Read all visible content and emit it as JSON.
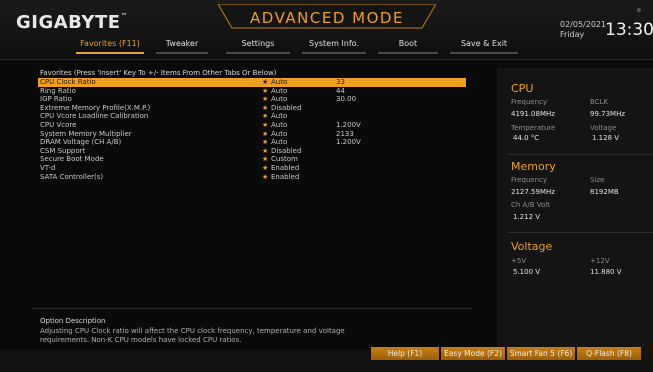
{
  "header": {
    "brand": "GIGABYTE",
    "brand_tm": "™",
    "mode_title": "ADVANCED MODE",
    "date": "02/05/2021",
    "day": "Friday",
    "time": "13:30"
  },
  "tabs": [
    {
      "label": "Favorites (F11)",
      "active": true
    },
    {
      "label": "Tweaker",
      "active": false
    },
    {
      "label": "Settings",
      "active": false
    },
    {
      "label": "System Info.",
      "active": false
    },
    {
      "label": "Boot",
      "active": false
    },
    {
      "label": "Save & Exit",
      "active": false
    }
  ],
  "favorites": {
    "heading": "Favorites (Press 'Insert' Key To +/- Items From Other Tabs Or Below)",
    "items": [
      {
        "label": "CPU Clock Ratio",
        "star": "★",
        "value": "Auto",
        "value2": "33"
      },
      {
        "label": "Ring Ratio",
        "star": "★",
        "value": "Auto",
        "value2": "44"
      },
      {
        "label": "IGP Ratio",
        "star": "★",
        "value": "Auto",
        "value2": "30.00"
      },
      {
        "label": "Extreme Memory Profile(X.M.P.)",
        "star": "★",
        "value": "Disabled",
        "value2": ""
      },
      {
        "label": "CPU Vcore Loadline Calibration",
        "star": "★",
        "value": "Auto",
        "value2": ""
      },
      {
        "label": "CPU Vcore",
        "star": "★",
        "value": "Auto",
        "value2": "1.200V"
      },
      {
        "label": "System Memory Multiplier",
        "star": "★",
        "value": "Auto",
        "value2": "2133"
      },
      {
        "label": "DRAM Voltage    (CH A/B)",
        "star": "★",
        "value": "Auto",
        "value2": "1.200V"
      },
      {
        "label": "CSM Support",
        "star": "★",
        "value": "Disabled",
        "value2": ""
      },
      {
        "label": "Secure Boot Mode",
        "star": "★",
        "value": "Custom",
        "value2": ""
      },
      {
        "label": "VT-d",
        "star": "★",
        "value": "Enabled",
        "value2": ""
      },
      {
        "label": "SATA Controller(s)",
        "star": "★",
        "value": "Enabled",
        "value2": ""
      }
    ]
  },
  "side": {
    "cpu": {
      "title": "CPU",
      "frequency_label": "Frequency",
      "frequency_value": "4191.08MHz",
      "bclk_label": "BCLK",
      "bclk_value": "99.73MHz",
      "temperature_label": "Temperature",
      "temperature_value": "44.0 °C",
      "voltage_label": "Voltage",
      "voltage_value": "1.128 V"
    },
    "memory": {
      "title": "Memory",
      "frequency_label": "Frequency",
      "frequency_value": "2127.59MHz",
      "size_label": "Size",
      "size_value": "8192MB",
      "volt_label": "Ch A/B Volt",
      "volt_value": "1.212 V"
    },
    "voltage": {
      "title": "Voltage",
      "v5_label": "+5V",
      "v5_value": "5.100 V",
      "v12_label": "+12V",
      "v12_value": "11.880 V"
    }
  },
  "description": {
    "title": "Option Description",
    "text": "Adjusting CPU Clock ratio will affect the CPU clock frequency, temperature and voltage requirements. Non-K CPU models have locked CPU ratios."
  },
  "footer": {
    "help": "Help (F1)",
    "easy_mode": "Easy Mode (F2)",
    "smart_fan": "Smart Fan 5 (F6)",
    "qflash": "Q-Flash (F8)"
  },
  "colors": {
    "accent": "#f0a020",
    "background": "#0a0a0a"
  }
}
